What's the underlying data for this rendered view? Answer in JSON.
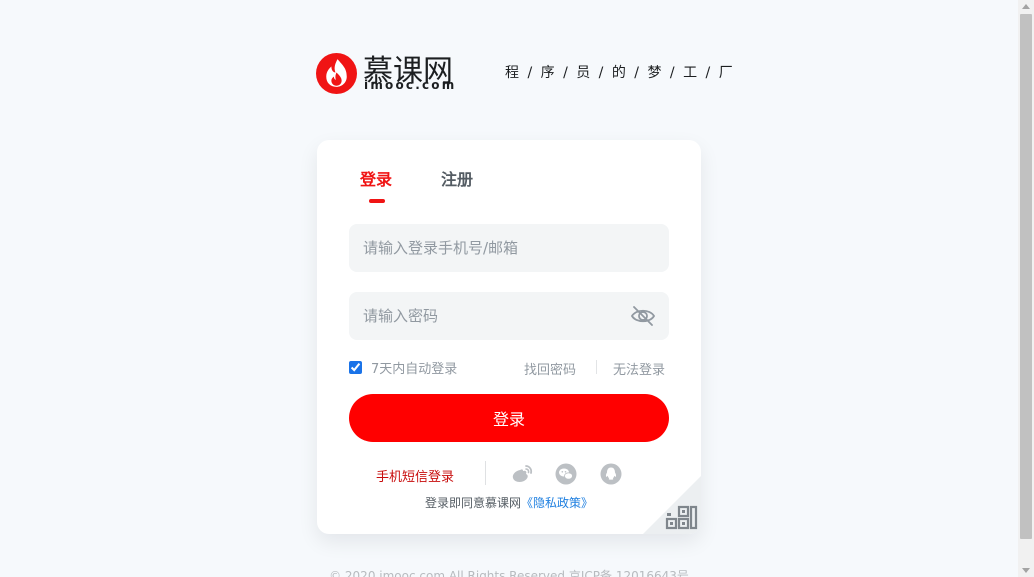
{
  "header": {
    "logo_name": "慕课网",
    "logo_domain": "imooc.com",
    "slogan": "程 / 序 / 员 / 的 / 梦 / 工 / 厂"
  },
  "tabs": {
    "login": "登录",
    "register": "注册"
  },
  "form": {
    "account_placeholder": "请输入登录手机号/邮箱",
    "password_placeholder": "请输入密码",
    "remember_label": "7天内自动登录",
    "remember_checked": true,
    "forgot_label": "找回密码",
    "cannot_login_label": "无法登录",
    "submit_label": "登录"
  },
  "social": {
    "sms_login_label": "手机短信登录",
    "icons": [
      "weibo-icon",
      "wechat-icon",
      "qq-icon"
    ]
  },
  "agreement": {
    "prefix": "登录即同意慕课网",
    "privacy_link": "《隐私政策》"
  },
  "footer": {
    "copyright": "© 2020 imooc.com All Rights Reserved 京ICP备 12016643号"
  },
  "colors": {
    "brand_red": "#ff0000",
    "tab_active": "#f01414",
    "link_blue": "#1e7fe0"
  }
}
